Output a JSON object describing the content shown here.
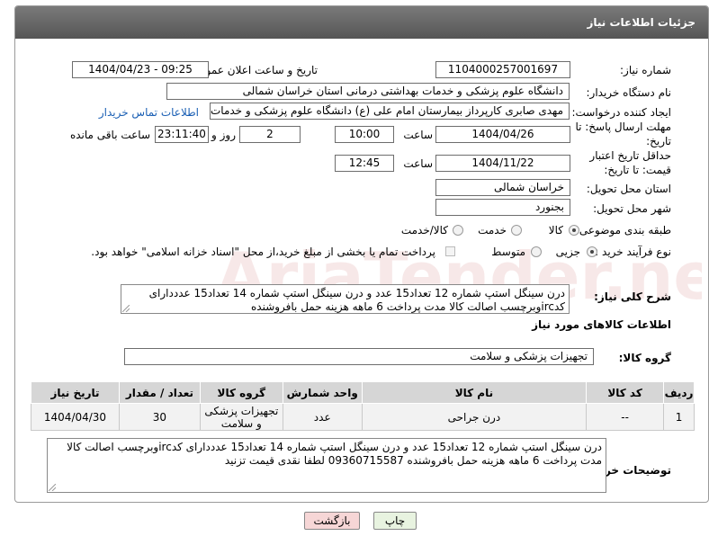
{
  "panel": {
    "title": "جزئیات اطلاعات نیاز"
  },
  "fields": {
    "need_number_label": "شماره نیاز:",
    "need_number": "1104000257001697",
    "announce_label": "تاریخ و ساعت اعلان عمومی:",
    "announce_value": "1404/04/23 - 09:25",
    "buyer_org_label": "نام دستگاه خریدار:",
    "buyer_org": "دانشگاه علوم پزشکی و خدمات بهداشتی درمانی استان خراسان شمالی",
    "requester_label": "ایجاد کننده درخواست:",
    "requester": "مهدی صابری کارپرداز بیمارستان امام علی (ع) دانشگاه علوم پزشکی و خدمات ب",
    "contact_link": "اطلاعات تماس خریدار",
    "reply_deadline_label": "مهلت ارسال پاسخ: تا تاریخ:",
    "reply_date": "1404/04/26",
    "time_label": "ساعت",
    "reply_time": "10:00",
    "days_value": "2",
    "days_label": "روز و",
    "remaining_time": "23:11:40",
    "remaining_label": "ساعت باقی مانده",
    "price_validity_label": "حداقل تاریخ اعتبار قیمت: تا تاریخ:",
    "price_date": "1404/11/22",
    "price_time": "12:45",
    "province_label": "استان محل تحویل:",
    "province": "خراسان شمالی",
    "city_label": "شهر محل تحویل:",
    "city": "بجنورد",
    "category_label": "طبقه بندی موضوعی:",
    "category_options": [
      "کالا",
      "خدمت",
      "کالا/خدمت"
    ],
    "process_label": "نوع فرآیند خرید :",
    "process_options": [
      "جزیی",
      "متوسط"
    ],
    "payment_note": "پرداخت تمام یا بخشی از مبلغ خرید،از محل \"اسناد خزانه اسلامی\" خواهد بود.",
    "general_desc_label": "شرح کلی نیاز:",
    "general_desc": "درن سینگل استپ شماره 12 تعداد15 عدد و درن سینگل استپ شماره 14 تعداد15 عدددارای کدircوبرچسب اصالت کالا مدت پرداخت 6 ماهه هزینه حمل بافروشنده"
  },
  "goods_section": {
    "title": "اطلاعات کالاهای مورد نیاز",
    "group_label": "گروه کالا:",
    "group_value": "تجهیزات پزشکی و سلامت"
  },
  "table": {
    "headers": [
      "ردیف",
      "کد کالا",
      "نام کالا",
      "واحد شمارش",
      "گروه کالا",
      "تعداد / مقدار",
      "تاریخ نیاز"
    ],
    "rows": [
      [
        "1",
        "--",
        "درن جراحی",
        "عدد",
        "تجهیزات پزشکی و سلامت",
        "30",
        "1404/04/30"
      ]
    ]
  },
  "buyer_notes": {
    "label": "توضیحات خریدار:",
    "text": "درن سینگل استپ شماره 12 تعداد15 عدد و درن سینگل استپ شماره 14 تعداد15 عدددارای کدircوبرچسب اصالت کالا مدت پرداخت 6 ماهه هزینه حمل بافروشنده 09360715587 لطفا نقدی قیمت تزنید"
  },
  "buttons": {
    "print": "چاپ",
    "back": "بازگشت"
  },
  "watermark": {
    "text": "AriaTender.net"
  },
  "colors": {
    "header_bg": "#666666",
    "link": "#1a5fb4",
    "back_btn_bg": "#f6d6d6",
    "print_btn_bg": "#e8f3e0"
  }
}
